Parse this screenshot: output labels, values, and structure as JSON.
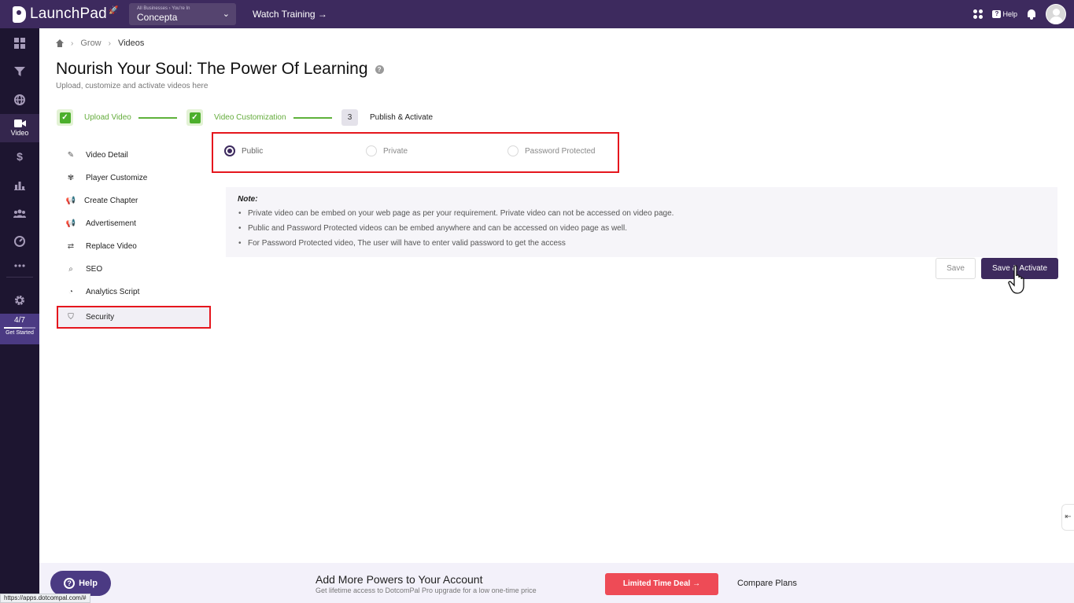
{
  "app": {
    "logo": "LaunchPad",
    "business_crumb": "All Businesses › You're In",
    "business_name": "Concepta",
    "watch_training": "Watch Training →",
    "help": "Help"
  },
  "sidebar": {
    "active_label": "Video",
    "progress": "4/7",
    "progress_fraction": 0.57,
    "get_started": "Get Started"
  },
  "breadcrumb": [
    "Grow",
    "Videos"
  ],
  "page": {
    "title": "Nourish Your Soul: The Power Of Learning",
    "subtitle": "Upload, customize and activate videos here"
  },
  "steps": [
    {
      "label": "Upload Video",
      "status": "done"
    },
    {
      "label": "Video Customization",
      "status": "done"
    },
    {
      "number": "3",
      "label": "Publish & Activate",
      "status": "current"
    }
  ],
  "menu": [
    {
      "label": "Video Detail",
      "icon": "edit-icon"
    },
    {
      "label": "Player Customize",
      "icon": "palette-icon"
    },
    {
      "label": "Create Chapter",
      "icon": "megaphone-icon"
    },
    {
      "label": "Advertisement",
      "icon": "megaphone-icon"
    },
    {
      "label": "Replace Video",
      "icon": "swap-icon"
    },
    {
      "label": "SEO",
      "icon": "magnifier-icon"
    },
    {
      "label": "Analytics Script",
      "icon": "chart-ring-icon"
    },
    {
      "label": "Security",
      "icon": "shield-icon"
    }
  ],
  "privacy": {
    "options": [
      "Public",
      "Private",
      "Password Protected"
    ],
    "selected": "Public"
  },
  "note": {
    "title": "Note:",
    "items": [
      "Private video can be embed on your web page as per your requirement. Private video can not be accessed on video page.",
      "Public and Password Protected videos can be embed anywhere and can be accessed on video page as well.",
      "For Password Protected video, The user will have to enter valid password to get the access"
    ]
  },
  "buttons": {
    "save": "Save",
    "save_activate": "Save & Activate"
  },
  "promo": {
    "title": "Add More Powers to Your Account",
    "subtitle": "Get lifetime access to DotcomPal Pro upgrade for a low one-time price",
    "deal": "Limited Time Deal →",
    "compare": "Compare Plans"
  },
  "help_button": "Help",
  "status_url": "https://apps.dotcompal.com/#",
  "colors": {
    "topbar": "#3d2a5e",
    "sidebar": "#1d1530",
    "accent_green": "#5eb23a",
    "highlight_red": "#e5161d",
    "deal_red": "#ee4b56"
  }
}
